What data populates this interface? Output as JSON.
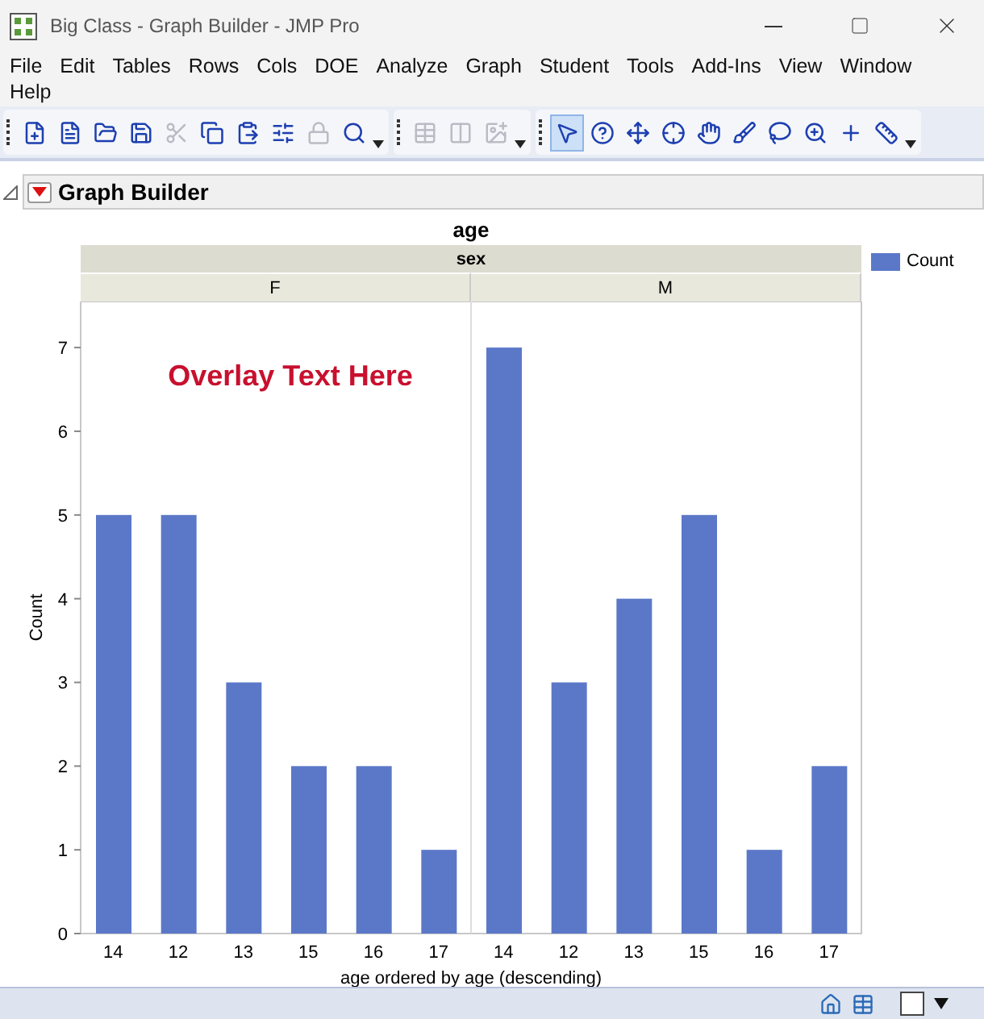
{
  "window": {
    "title": "Big Class - Graph Builder - JMP Pro"
  },
  "menu": [
    "File",
    "Edit",
    "Tables",
    "Rows",
    "Cols",
    "DOE",
    "Analyze",
    "Graph",
    "Student",
    "Tools",
    "Add-Ins",
    "View",
    "Window",
    "Help"
  ],
  "toolbar": [
    [
      {
        "disabled": false,
        "selected": false
      },
      {
        "disabled": false,
        "selected": false
      },
      {
        "disabled": false,
        "selected": false
      },
      {
        "disabled": false,
        "selected": false
      },
      {
        "disabled": true,
        "selected": false
      },
      {
        "disabled": false,
        "selected": false
      },
      {
        "disabled": false,
        "selected": false
      },
      {
        "disabled": false,
        "selected": false
      },
      {
        "disabled": true,
        "selected": false
      },
      {
        "disabled": false,
        "selected": false
      }
    ],
    [
      {
        "disabled": true,
        "selected": false
      },
      {
        "disabled": true,
        "selected": false
      },
      {
        "disabled": true,
        "selected": false
      }
    ],
    [
      {
        "disabled": false,
        "selected": true
      },
      {
        "disabled": false,
        "selected": false
      },
      {
        "disabled": false,
        "selected": false
      },
      {
        "disabled": false,
        "selected": false
      },
      {
        "disabled": false,
        "selected": false
      },
      {
        "disabled": false,
        "selected": false
      },
      {
        "disabled": false,
        "selected": false
      },
      {
        "disabled": false,
        "selected": false
      },
      {
        "disabled": false,
        "selected": false
      },
      {
        "disabled": false,
        "selected": false
      }
    ]
  ],
  "report": {
    "title": "Graph Builder",
    "expanded": true
  },
  "graph": {
    "title": "age",
    "group_label": "sex",
    "panels": [
      "F",
      "M"
    ],
    "overlay_text": "Overlay Text Here",
    "chart_data": {
      "type": "bar",
      "xlabel": "age ordered by age (descending)",
      "ylabel": "Count",
      "categories": [
        "14",
        "12",
        "13",
        "15",
        "16",
        "17",
        "14",
        "12",
        "13",
        "15",
        "16",
        "17"
      ],
      "series": [
        {
          "name": "Count",
          "color": "#5b78c8",
          "values": [
            5,
            5,
            3,
            2,
            2,
            1,
            7,
            3,
            4,
            5,
            1,
            2
          ]
        }
      ],
      "ylim": [
        0,
        7.55
      ],
      "yticks": [
        0,
        1,
        2,
        3,
        4,
        5,
        6,
        7
      ]
    }
  }
}
